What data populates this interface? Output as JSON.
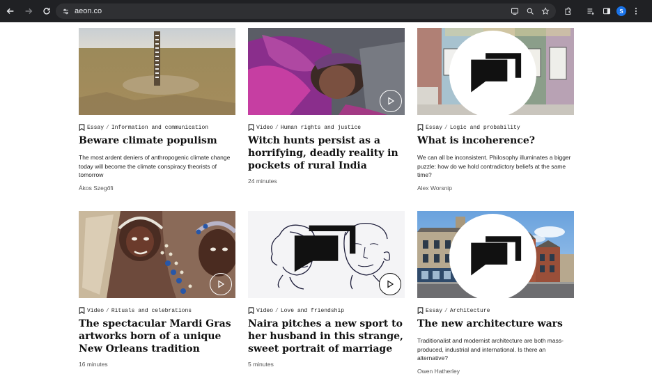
{
  "browser": {
    "url": "aeon.co",
    "profile_initial": "S"
  },
  "cards": [
    {
      "kind": "Essay",
      "topic": "Information and communication",
      "title": "Beware climate populism",
      "description": "The most ardent deniers of anthropogenic climate change today will become the climate conspiracy theorists of tomorrow",
      "author": "Ákos Szegőfi"
    },
    {
      "kind": "Video",
      "topic": "Human rights and justice",
      "title": "Witch hunts persist as a horrifying, deadly reality in pockets of rural India",
      "duration": "24 minutes"
    },
    {
      "kind": "Essay",
      "topic": "Logic and probability",
      "title": "What is incoherence?",
      "description": "We can all be inconsistent. Philosophy illuminates a bigger puzzle: how do we hold contradictory beliefs at the same time?",
      "author": "Alex Worsnip"
    },
    {
      "kind": "Video",
      "topic": "Rituals and celebrations",
      "title": "The spectacular Mardi Gras artworks born of a unique New Orleans tradition",
      "duration": "16 minutes"
    },
    {
      "kind": "Video",
      "topic": "Love and friendship",
      "title": "Naira pitches a new sport to her husband in this strange, sweet portrait of marriage",
      "duration": "5 minutes"
    },
    {
      "kind": "Essay",
      "topic": "Architecture",
      "title": "The new architecture wars",
      "description": "Traditionalist and modernist architecture are both mass-produced, industrial and international. Is there an alternative?",
      "author": "Owen Hatherley"
    }
  ],
  "icons": {
    "back": "arrow-left-icon",
    "forward": "arrow-right-icon",
    "reload": "reload-icon",
    "site_info": "tune-icon",
    "bookmark": "bookmark-icon",
    "play": "play-icon",
    "comments": "speech-bubble-icon"
  }
}
